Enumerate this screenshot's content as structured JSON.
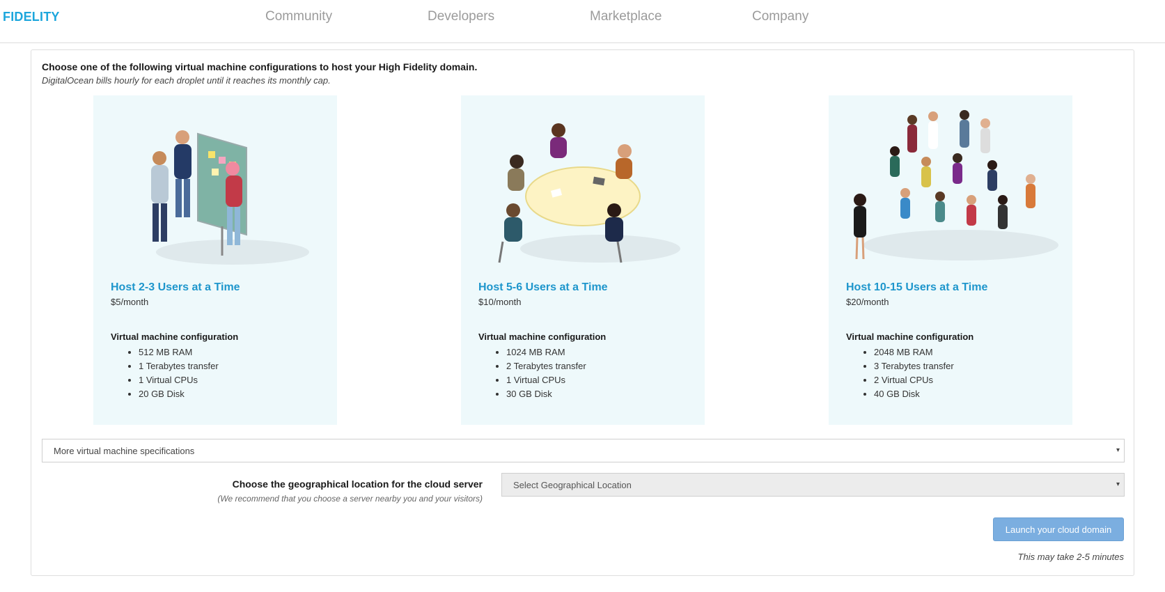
{
  "nav": {
    "brand": "FIDELITY",
    "links": [
      "Community",
      "Developers",
      "Marketplace",
      "Company"
    ]
  },
  "intro": {
    "heading": "Choose one of the following virtual machine configurations to host your High Fidelity domain.",
    "subtext": "DigitalOcean bills hourly for each droplet until it reaches its monthly cap."
  },
  "cards": [
    {
      "title": "Host 2-3 Users at a Time",
      "price": "$5/month",
      "config_heading": "Virtual machine configuration",
      "specs": [
        "512 MB RAM",
        "1 Terabytes transfer",
        "1 Virtual CPUs",
        "20 GB Disk"
      ]
    },
    {
      "title": "Host 5-6 Users at a Time",
      "price": "$10/month",
      "config_heading": "Virtual machine configuration",
      "specs": [
        "1024 MB RAM",
        "2 Terabytes transfer",
        "1 Virtual CPUs",
        "30 GB Disk"
      ]
    },
    {
      "title": "Host 10-15 Users at a Time",
      "price": "$20/month",
      "config_heading": "Virtual machine configuration",
      "specs": [
        "2048 MB RAM",
        "3 Terabytes transfer",
        "2 Virtual CPUs",
        "40 GB Disk"
      ]
    }
  ],
  "more_specs": {
    "selected": "More virtual machine specifications",
    "caret": "▾"
  },
  "geo": {
    "label": "Choose the geographical location for the cloud server",
    "note": "(We recommend that you choose a server nearby you and your visitors)",
    "selected": "Select Geographical Location",
    "caret": "▾"
  },
  "launch": {
    "label": "Launch your cloud domain",
    "note": "This may take 2-5 minutes"
  },
  "colors": {
    "brand": "#1ca6dc",
    "card_title": "#1e96cc",
    "card_bg": "#eef9fb",
    "button": "#7baee0"
  }
}
